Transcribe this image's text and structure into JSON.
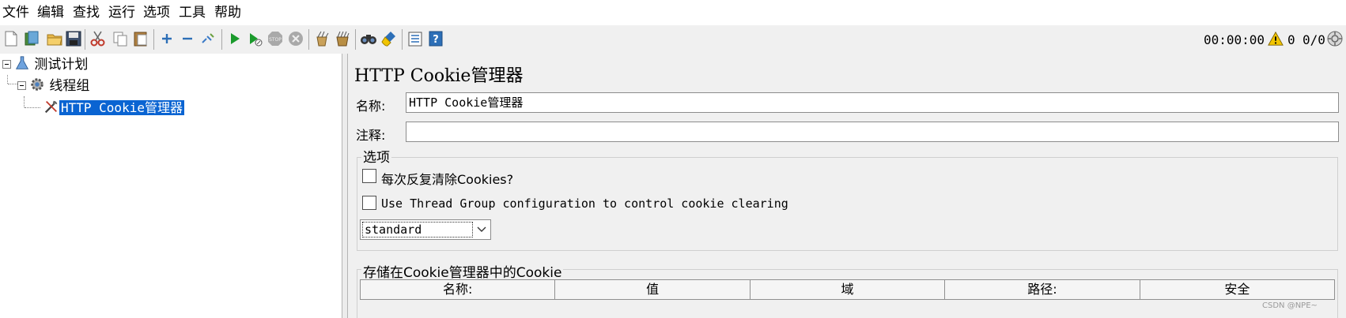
{
  "menu": {
    "file": "文件",
    "edit": "编辑",
    "search": "查找",
    "run": "运行",
    "options": "选项",
    "tools": "工具",
    "help": "帮助"
  },
  "toolbar": {
    "icons": [
      "new-icon",
      "templates-icon",
      "open-icon",
      "save-icon",
      "cut-icon",
      "copy-icon",
      "paste-icon",
      "expand-icon",
      "collapse-icon",
      "toggle-icon",
      "start-icon",
      "start-no-pause-icon",
      "stop-icon",
      "shutdown-icon",
      "clear-icon",
      "clear-all-icon",
      "search-icon",
      "reset-search-icon",
      "function-helper-icon",
      "help-icon"
    ]
  },
  "status": {
    "elapsed": "00:00:00",
    "warnings": "0",
    "threads": "0/0"
  },
  "tree": {
    "test_plan": "测试计划",
    "thread_group": "线程组",
    "cookie_manager": "HTTP Cookie管理器"
  },
  "panel": {
    "title": "HTTP Cookie管理器",
    "name_label": "名称:",
    "name_value": "HTTP Cookie管理器",
    "comment_label": "注释:",
    "comment_value": "",
    "options_legend": "选项",
    "clear_each_iteration": "每次反复清除Cookies?",
    "clear_each_iteration_checked": false,
    "use_thread_group": "Use Thread Group configuration to control cookie clearing",
    "use_thread_group_checked": false,
    "policy_selected": "standard",
    "stored_legend": "存储在Cookie管理器中的Cookie",
    "columns": [
      "名称:",
      "值",
      "域",
      "路径:",
      "安全"
    ]
  },
  "watermark": "CSDN @NPE~",
  "colors": {
    "selection": "#0a64d2",
    "run_green": "#1a9a2c",
    "warning_yellow": "#f2c500"
  }
}
